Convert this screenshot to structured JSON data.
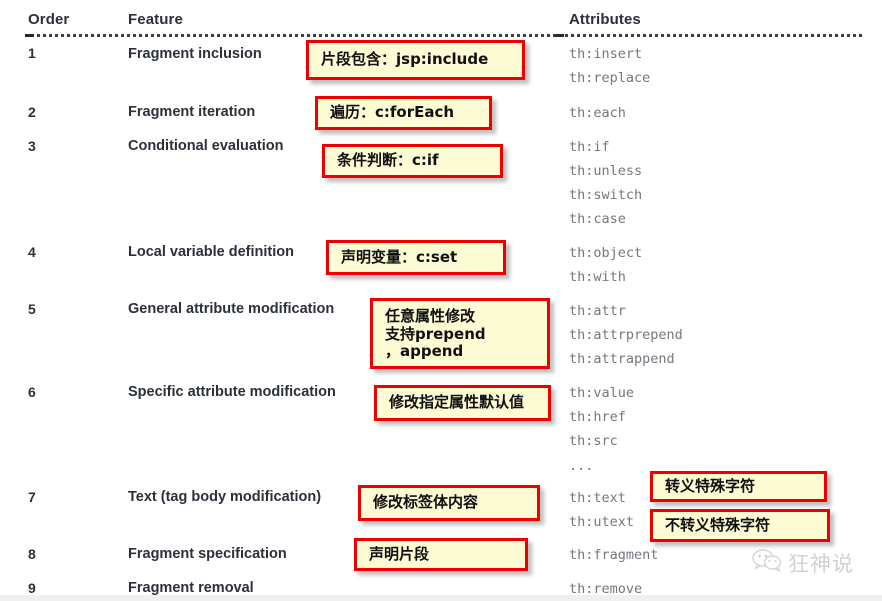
{
  "table": {
    "headers": [
      "Order",
      "Feature",
      "Attributes"
    ],
    "rows": [
      {
        "order": "1",
        "feature": "Fragment inclusion",
        "attributes": [
          "th:insert",
          "th:replace"
        ]
      },
      {
        "order": "2",
        "feature": "Fragment iteration",
        "attributes": [
          "th:each"
        ]
      },
      {
        "order": "3",
        "feature": "Conditional evaluation",
        "attributes": [
          "th:if",
          "th:unless",
          "th:switch",
          "th:case"
        ]
      },
      {
        "order": "4",
        "feature": "Local variable definition",
        "attributes": [
          "th:object",
          "th:with"
        ]
      },
      {
        "order": "5",
        "feature": "General attribute modification",
        "attributes": [
          "th:attr",
          "th:attrprepend",
          "th:attrappend"
        ]
      },
      {
        "order": "6",
        "feature": "Specific attribute modification",
        "attributes": [
          "th:value",
          "th:href",
          "th:src",
          "..."
        ]
      },
      {
        "order": "7",
        "feature": "Text (tag body modification)",
        "attributes": [
          "th:text",
          "th:utext"
        ]
      },
      {
        "order": "8",
        "feature": "Fragment specification",
        "attributes": [
          "th:fragment"
        ]
      },
      {
        "order": "9",
        "feature": "Fragment removal",
        "attributes": [
          "th:remove"
        ]
      }
    ]
  },
  "annotations": [
    {
      "id": "fragment-inclusion",
      "text": "片段包含：jsp:include"
    },
    {
      "id": "fragment-iteration",
      "text": "遍历：c:forEach"
    },
    {
      "id": "conditional",
      "text": "条件判断：c:if"
    },
    {
      "id": "local-variable",
      "text": "声明变量：c:set"
    },
    {
      "id": "general-attribute",
      "text": "任意属性修改\n支持prepend\n，append"
    },
    {
      "id": "specific-attribute",
      "text": "修改指定属性默认值"
    },
    {
      "id": "text-body",
      "text": "修改标签体内容"
    },
    {
      "id": "escape-special",
      "text": "转义特殊字符"
    },
    {
      "id": "no-escape-special",
      "text": "不转义特殊字符"
    },
    {
      "id": "fragment-spec",
      "text": "声明片段"
    }
  ],
  "watermark": {
    "text": "狂神说"
  },
  "colors": {
    "note_fill": "#fdfbd4",
    "note_border": "#ef0000",
    "heading_text": "#2b3039",
    "attribute_text": "#72787e",
    "watermark_text": "#c9c9c9",
    "background": "#ffffff"
  }
}
